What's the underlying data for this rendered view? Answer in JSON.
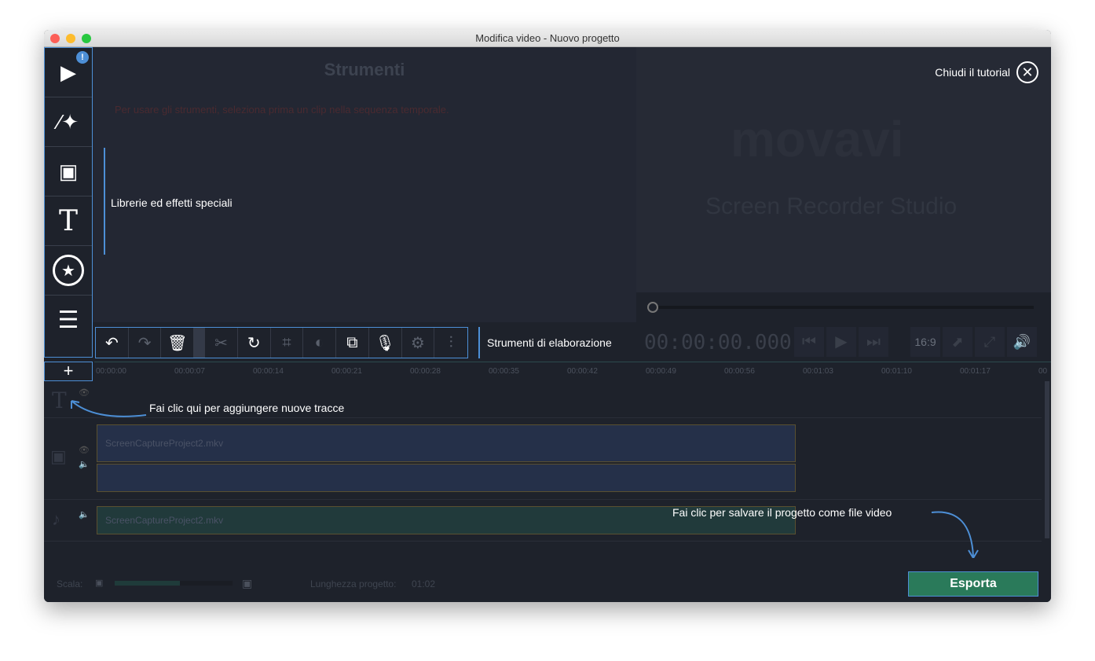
{
  "window": {
    "title": "Modifica video - Nuovo progetto"
  },
  "sidebar": {
    "badge": "!",
    "items": [
      {
        "name": "media"
      },
      {
        "name": "filters"
      },
      {
        "name": "transitions"
      },
      {
        "name": "titles"
      },
      {
        "name": "stickers"
      },
      {
        "name": "menu"
      }
    ]
  },
  "tools": {
    "title": "Strumenti",
    "hint": "Per usare gli strumenti, seleziona prima un clip nella sequenza temporale."
  },
  "preview": {
    "close_tutorial": "Chiudi il tutorial",
    "logo": "movavi",
    "product": "Screen Recorder Studio"
  },
  "tutorial": {
    "libraries": "Librerie ed effetti speciali",
    "editing_tools": "Strumenti di elaborazione",
    "add_tracks": "Fai clic qui per aggiungere nuove tracce",
    "save_video": "Fai clic per salvare il progetto come file video"
  },
  "player": {
    "timecode": "00:00:00.000",
    "aspect": "16:9"
  },
  "ruler": [
    "00:00:00",
    "00:00:07",
    "00:00:14",
    "00:00:21",
    "00:00:28",
    "00:00:35",
    "00:00:42",
    "00:00:49",
    "00:00:56",
    "00:01:03",
    "00:01:10",
    "00:01:17",
    "00"
  ],
  "clips": {
    "video": "ScreenCaptureProject2.mkv",
    "audio": "ScreenCaptureProject2.mkv"
  },
  "bottom": {
    "scale_label": "Scala:",
    "scale_value": 0.55,
    "length_label": "Lunghezza progetto:",
    "length_value": "01:02",
    "export": "Esporta"
  }
}
